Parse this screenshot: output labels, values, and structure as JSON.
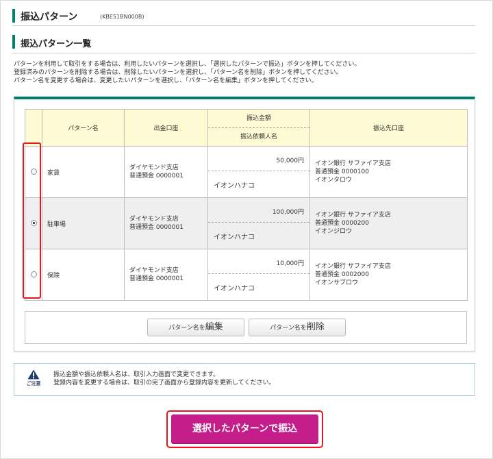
{
  "page": {
    "title": "振込パターン",
    "code": "(KBE51BN000B)",
    "subtitle": "振込パターン一覧",
    "instructions": [
      "パターンを利用して取引をする場合は、利用したいパターンを選択し、「選択したパターンで振込」ボタンを押してください。",
      "登録済みのパターンを削除する場合は、削除したいパターンを選択し、「パターン名を削除」ボタンを押してください。",
      "パターン名を変更する場合は、変更したいパターンを選択し、「パターン名を編集」ボタンを押してください。"
    ]
  },
  "table": {
    "headers": {
      "pattern_name": "パターン名",
      "from_account": "出金口座",
      "amount": "振込金額",
      "requester": "振込依頼人名",
      "destination": "振込先口座"
    },
    "rows": [
      {
        "selected": false,
        "name": "家賃",
        "account_branch": "ダイヤモンド支店",
        "account_number": "普通預金 0000001",
        "amount": "50,000円",
        "requester": "イオンハナコ",
        "dest_bank": "イオン銀行 サファイア支店",
        "dest_account": "普通預金 0000100",
        "dest_name": "イオンタロウ"
      },
      {
        "selected": true,
        "name": "駐車場",
        "account_branch": "ダイヤモンド支店",
        "account_number": "普通預金 0000001",
        "amount": "100,000円",
        "requester": "イオンハナコ",
        "dest_bank": "イオン銀行 サファイア支店",
        "dest_account": "普通預金 0000200",
        "dest_name": "イオンジロウ"
      },
      {
        "selected": false,
        "name": "保険",
        "account_branch": "ダイヤモンド支店",
        "account_number": "普通預金 0000001",
        "amount": "10,000円",
        "requester": "イオンハナコ",
        "dest_bank": "イオン銀行 サファイア支店",
        "dest_account": "普通預金 0002000",
        "dest_name": "イオンサブロウ"
      }
    ]
  },
  "buttons": {
    "edit_prefix": "パターン名を",
    "edit_main": "編集",
    "delete_prefix": "パターン名を",
    "delete_main": "削除",
    "submit": "選択したパターンで振込"
  },
  "notice": {
    "icon": "warning-triangle-icon",
    "label": "ご注意",
    "lines": [
      "振込金額や振込依頼人名は、取引入力画面で変更できます。",
      "登録内容を変更する場合は、取引の完了画面から登録内容を更新してください。"
    ]
  },
  "colors": {
    "accent_green": "#00806a",
    "header_yellow": "#fdfad4",
    "submit_magenta": "#c51e8b",
    "highlight_red": "#e8141d",
    "notice_border": "#a7d3df"
  }
}
